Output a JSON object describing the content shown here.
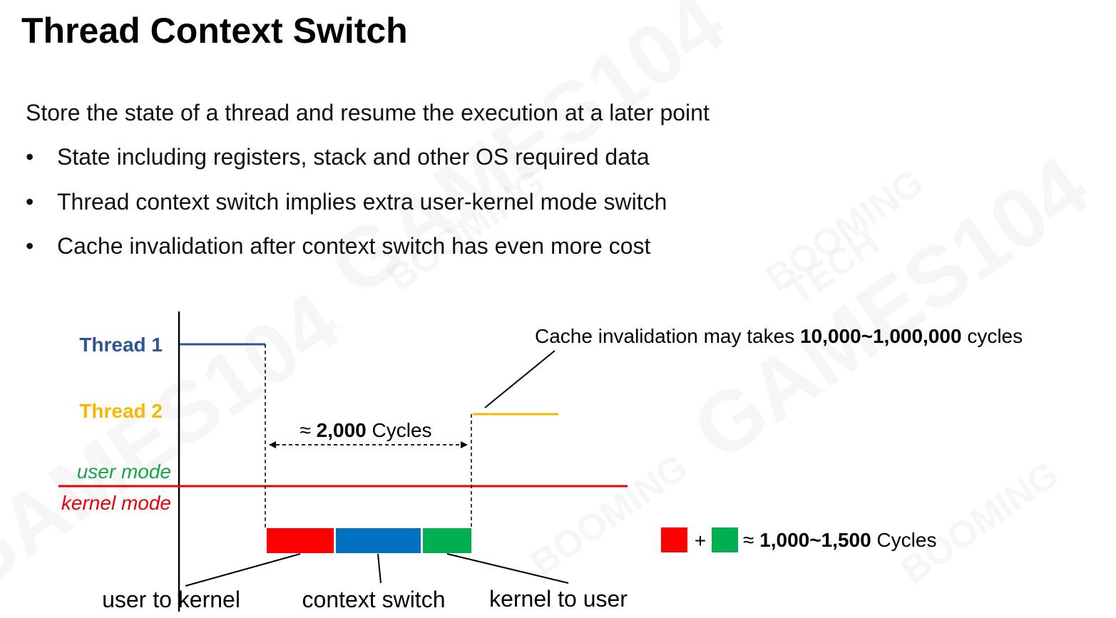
{
  "title": "Thread Context Switch",
  "intro": "Store the state of a thread and resume the execution at a later point",
  "bullets": [
    "State including registers, stack and other OS required data",
    "Thread context switch implies extra user-kernel mode switch",
    "Cache invalidation after context switch has even more cost"
  ],
  "bullet_symbol": "•",
  "diagram": {
    "thread1_label": "Thread 1",
    "thread2_label": "Thread 2",
    "user_mode_label": "user mode",
    "kernel_mode_label": "kernel mode",
    "cycles_prefix": "≈ ",
    "cycles_value": "2,000",
    "cycles_suffix": " Cycles",
    "cache_prefix": "Cache invalidation may takes ",
    "cache_value": "10,000~1,000,000",
    "cache_suffix": " cycles",
    "seg_user_to_kernel": "user to kernel",
    "seg_context_switch": "context switch",
    "seg_kernel_to_user": "kernel to user",
    "legend_plus": "+",
    "legend_prefix": "≈ ",
    "legend_value": "1,000~1,500",
    "legend_suffix": " Cycles",
    "colors": {
      "thread1": "#2f5597",
      "thread2": "#f5b800",
      "user_mode": "#1aa34a",
      "kernel_mode": "#e8000b",
      "red_block": "#ff0000",
      "blue_block": "#0070c0",
      "green_block": "#00b050"
    }
  },
  "watermark": {
    "main": "GAMES104",
    "brand_line1": "BOOMING",
    "brand_line2": "TECH"
  }
}
